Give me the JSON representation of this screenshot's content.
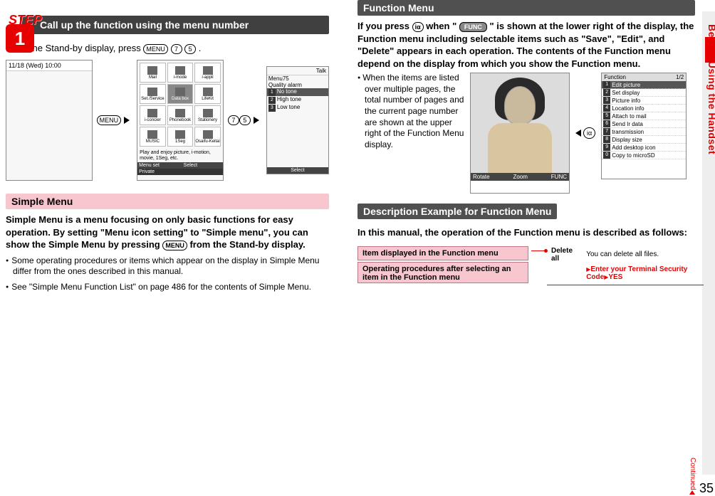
{
  "step": {
    "label": "STEP",
    "num": "1",
    "title": "Call up the function using the menu number"
  },
  "standby_line_pre": "From the Stand-by display, press ",
  "standby_btn_menu": "MENU",
  "standby_btn_7": "7",
  "standby_btn_5": "5",
  "standby_period": ".",
  "screen1": {
    "time": "11/18 (Wed) 10:00"
  },
  "arrow1_btn": "MENU",
  "screen2": {
    "icons": [
      "Mail",
      "i-mode",
      "i-appli",
      "Set./Service",
      "Data box",
      "LifeKit",
      "i-concier",
      "Phonebook",
      "Stationery",
      "MUSIC",
      "1Seg",
      "Osaifu-Keitai"
    ],
    "caption": "Play and enjoy picture, i-motion, movie, 1Seg, etc.",
    "soft": [
      "Menu set",
      "Select",
      ""
    ],
    "softextra": "Private"
  },
  "arrow2_btn1": "7",
  "arrow2_btn2": "5",
  "screen3": {
    "talk": "Talk",
    "menu": "Menu75",
    "title": "Quality alarm",
    "items": [
      "No tone",
      "High tone",
      "Low tone"
    ],
    "soft": [
      "",
      "Select",
      ""
    ]
  },
  "simple": {
    "heading": "Simple Menu",
    "body": "Simple Menu is a menu focusing on only basic functions for easy operation. By setting \"Menu icon setting\" to \"Simple menu\", you can show the Simple Menu by pressing ",
    "body2": " from the Stand-by display.",
    "bullet1": "Some operating procedures or items which appear on the display in Simple Menu differ from the ones described in this manual.",
    "bullet2": "See \"Simple Menu Function List\" on page 486 for the contents of Simple Menu."
  },
  "func": {
    "heading": "Function Menu",
    "intro1": "If you press ",
    "intro_key": "iα",
    "intro2": " when \"",
    "intro_badge": "FUNC",
    "intro3": "\" is shown at the lower right of the display, the Function menu including selectable items such as \"Save\", \"Edit\", and \"Delete\" appears in each operation. The contents of the Function menu depend on the display from which you show the Function menu.",
    "note": "When the items are listed over multiple pages, the total number of pages and the current page number are shown at the upper right of the Function Menu display.",
    "photo_soft": [
      "Rotate",
      "Zoom",
      "FUNC"
    ],
    "ia_arrow_key": "iα",
    "fmenu": {
      "hdr": "Function",
      "page": "1/2",
      "items": [
        "Edit picture",
        "Set display",
        "Picture info",
        "Location info",
        "Attach to mail",
        "Send Ir data",
        "  transmission",
        "Display size",
        "Add desktop icon",
        "Copy to microSD"
      ]
    }
  },
  "desc": {
    "heading": "Description Example for Function Menu",
    "intro": "In this manual, the operation of the Function menu is described as follows:",
    "box1": "Item displayed in the Function menu",
    "box2": "Operating procedures after selecting an item in the Function menu",
    "op": "Delete all",
    "optxt": "You can delete all files.",
    "opline": "Enter your Terminal Security Code",
    "opyes": "YES"
  },
  "sidebar_text": "Before Using the Handset",
  "continued": "Continued",
  "page_num": "35"
}
